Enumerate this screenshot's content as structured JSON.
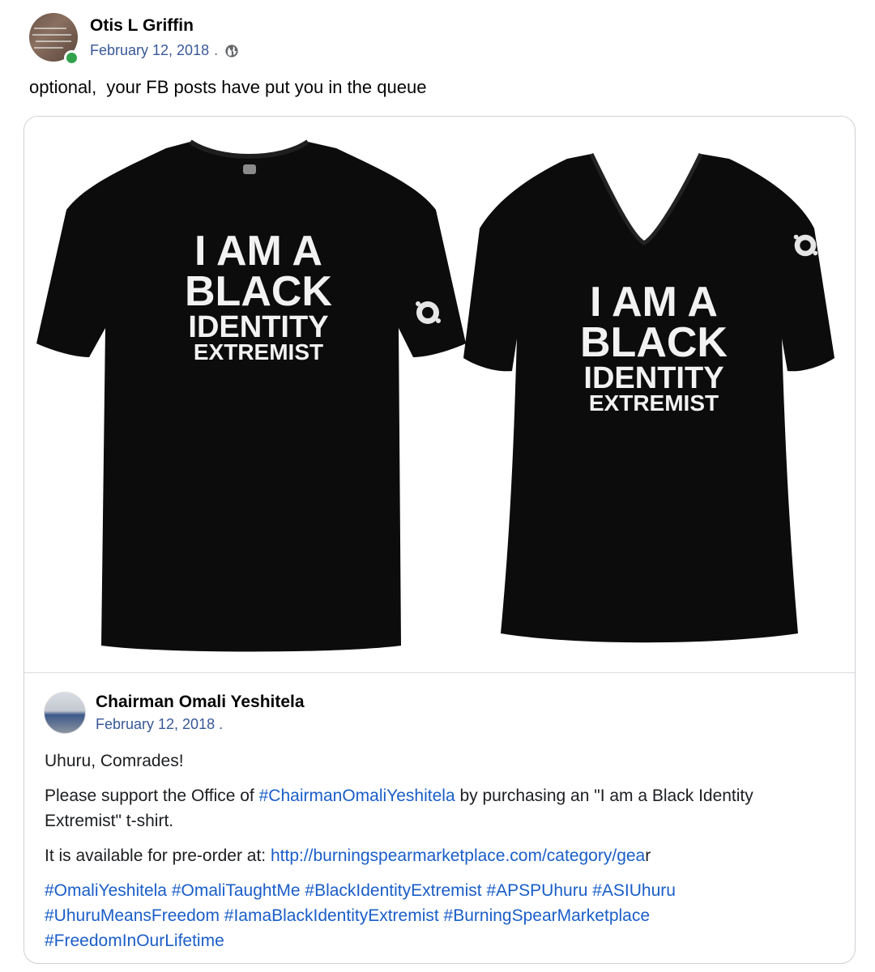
{
  "post": {
    "author": "Otis L Griffin",
    "date": "February 12, 2018",
    "separator": ".",
    "privacy_icon": "globe-icon",
    "text": "optional,  your FB posts have put you in the queue"
  },
  "shared_image": {
    "left_shirt": {
      "lines": [
        "I AM A",
        "BLACK",
        "IDENTITY",
        "EXTREMIST"
      ]
    },
    "right_shirt": {
      "lines": [
        "I AM A",
        "BLACK",
        "IDENTITY",
        "EXTREMIST"
      ]
    }
  },
  "shared_post": {
    "author": "Chairman Omali Yeshitela",
    "date": "February 12, 2018",
    "separator": ".",
    "greeting": "Uhuru, Comrades!",
    "support_pre": "Please support the Office of ",
    "support_hashtag": "#ChairmanOmaliYeshitela",
    "support_post": " by purchasing an \"I am a Black Identity Extremist\" t-shirt.",
    "available_pre": "It is available for pre-order at: ",
    "available_link": "http://burningspearmarketplace.com/category/gea",
    "available_link_tail": "r",
    "hashtags": "#OmaliYeshitela #OmaliTaughtMe #BlackIdentityExtremist #APSPUhuru #ASIUhuru #UhuruMeansFreedom #IamaBlackIdentityExtremist #BurningSpearMarketplace #FreedomInOurLifetime"
  },
  "colors": {
    "link": "#1a5ec8",
    "date": "#385898",
    "online": "#31a24c",
    "shirt": "#0c0c0c"
  }
}
